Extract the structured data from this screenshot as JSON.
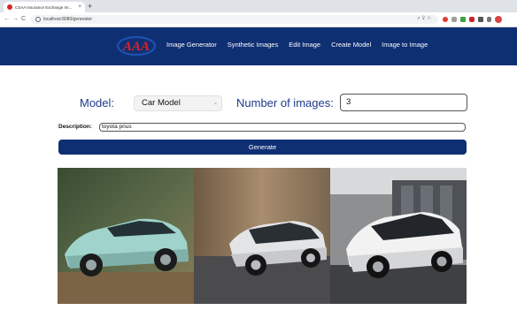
{
  "browser": {
    "tab_title": "CSAA Insurance Exchange Im...",
    "tab_close": "×",
    "new_tab": "+",
    "url": "localhost:8080/generator",
    "back": "←",
    "forward": "→",
    "reload": "C"
  },
  "header": {
    "logo_text": "AAA",
    "nav": [
      "Image Generator",
      "Synthetic Images",
      "Edit Image",
      "Create Model",
      "Image to Image"
    ]
  },
  "form": {
    "model_label": "Model:",
    "model_value": "Car Model",
    "num_label": "Number of images:",
    "num_value": "3",
    "desc_label": "Description:",
    "desc_value": "toyota prius",
    "generate_label": "Generate"
  },
  "colors": {
    "brand_navy": "#0f2f73",
    "brand_red": "#d8232a",
    "label_blue": "#1f3a8a"
  },
  "gallery": {
    "images": [
      {
        "subject": "car-mint-prius"
      },
      {
        "subject": "car-silver-prius-canyon"
      },
      {
        "subject": "car-white-prius-building"
      }
    ]
  }
}
